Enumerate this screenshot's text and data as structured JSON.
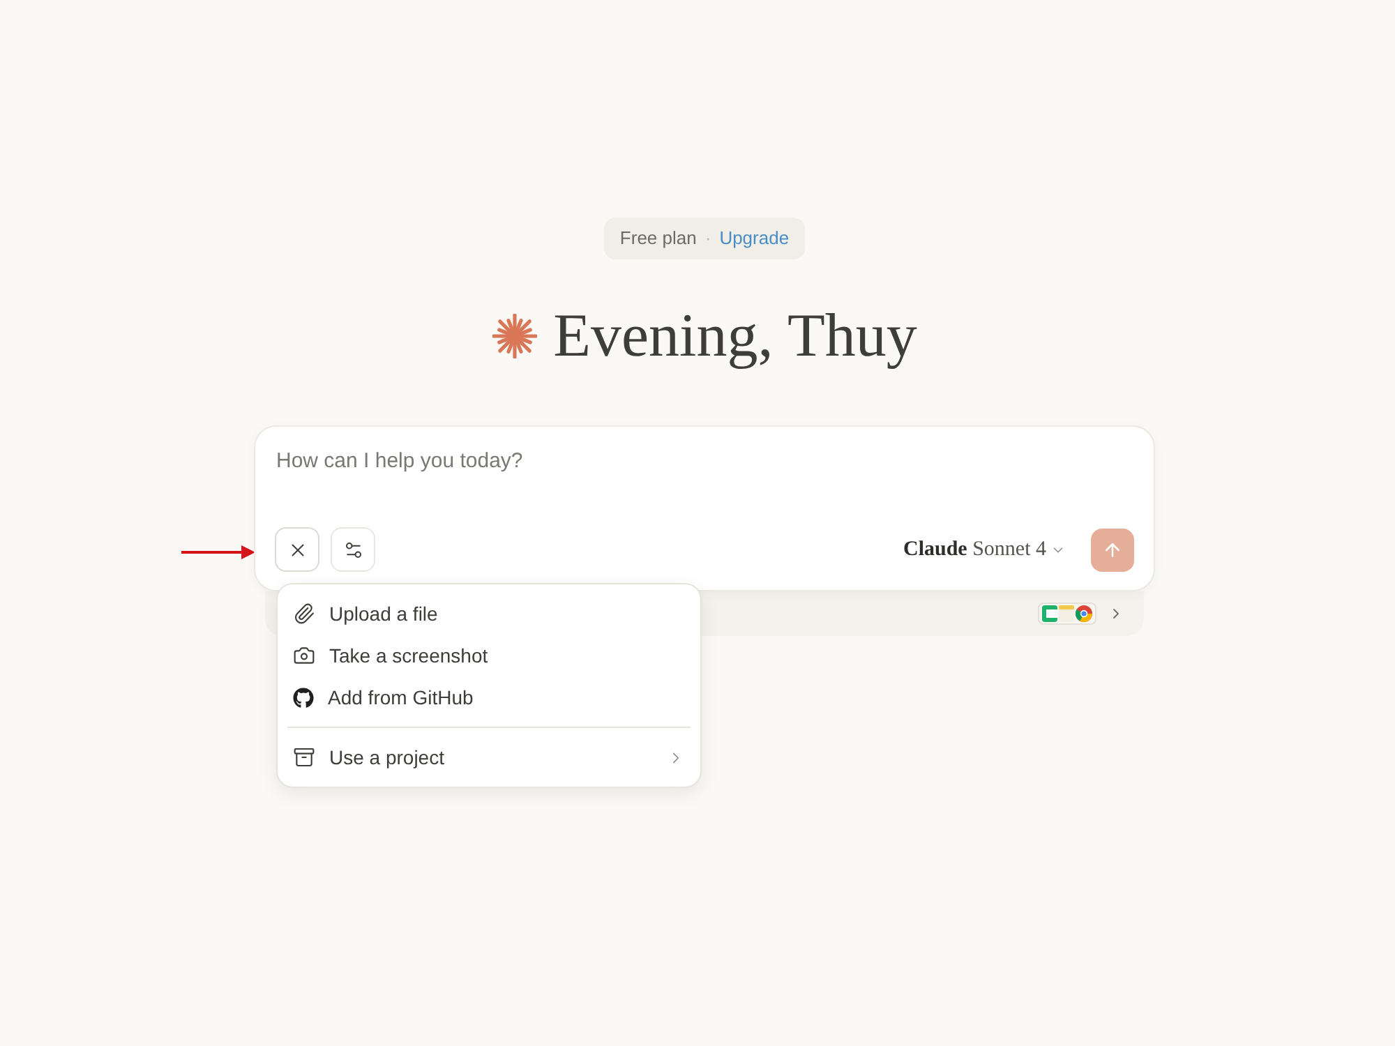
{
  "plan_badge": {
    "plan": "Free plan",
    "separator": "·",
    "link": "Upgrade"
  },
  "greeting": "Evening, Thuy",
  "composer": {
    "placeholder": "How can I help you today?",
    "menu_open": true,
    "model": "**Claude** Sonnet 4",
    "send_disabled": true
  },
  "attach_menu": {
    "sections": [
      {
        "items": [
          {
            "kind": "upload",
            "label": "Upload a file",
            "submenu": false
          },
          {
            "kind": "screenshot",
            "label": "Take a screenshot",
            "submenu": false
          },
          {
            "kind": "github",
            "label": "Add from GitHub",
            "submenu": false
          }
        ]
      },
      {
        "items": [
          {
            "kind": "project",
            "label": "Use a project",
            "submenu": true
          }
        ]
      }
    ]
  }
}
